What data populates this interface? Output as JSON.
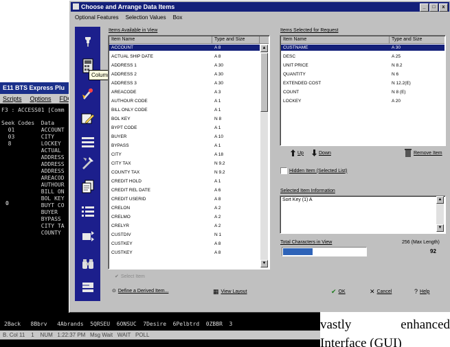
{
  "terminal": {
    "title": "E11 BTS Express Plu",
    "menu": [
      "Scripts",
      "Options",
      "FDC"
    ],
    "lines": [
      "F3 : ACCESS01 [Comm",
      "Seek Codes  Data",
      "  01        ACCOUNT",
      "  03        CITY",
      "  8         LOCKEY",
      "            ACTUAL",
      "            ADDRESS",
      "            ADDRESS",
      "            ADDRESS",
      "            AREACOD",
      "            AUTHOUR",
      "            BILL ON",
      "            BOL KEY",
      "            BUYT CO",
      "            BUYER",
      "            BYPASS",
      "            CITY TA",
      "            COUNTY"
    ],
    "cursor_char": "0",
    "status_line": "2Back   8Bbrv   4Abrands  5QRSEU  6ONSUC  7Desire  6Pelbtrd  0ZBBR  3",
    "status_bar": "B. Col 11    1    NUM   1:22:37 PM   Msg Wait   WAIT   POLL"
  },
  "dialog": {
    "title": "Choose and Arrange Data Items",
    "window_buttons": [
      "_",
      "□",
      "x"
    ],
    "menu": [
      "Optional Features",
      "Selection Values",
      "Box"
    ],
    "tooltip": "Column Calculations",
    "available": {
      "label": "Items Available in View",
      "col_name": "Item Name",
      "col_type": "Type and Size",
      "rows": [
        {
          "name": "ACCOUNT",
          "type": "A 8",
          "selected": true
        },
        {
          "name": "ACTUAL SHIP DATE",
          "type": "A 8"
        },
        {
          "name": "ADDRESS 1",
          "type": "A 30"
        },
        {
          "name": "ADDRESS 2",
          "type": "A 30"
        },
        {
          "name": "ADDRESS 3",
          "type": "A 30"
        },
        {
          "name": "AREACODE",
          "type": "A 3"
        },
        {
          "name": "AUTHOUR CODE",
          "type": "A 1"
        },
        {
          "name": "BILL ONLY CODE",
          "type": "A 1"
        },
        {
          "name": "BOL KEY",
          "type": "N 8"
        },
        {
          "name": "BYPT CODE",
          "type": "A 1"
        },
        {
          "name": "BUYER",
          "type": "A 10"
        },
        {
          "name": "BYPASS",
          "type": "A 1"
        },
        {
          "name": "CITY",
          "type": "A 18"
        },
        {
          "name": "CITY TAX",
          "type": "N 9.2"
        },
        {
          "name": "COUNTY TAX",
          "type": "N 9.2"
        },
        {
          "name": "CREDIT HOLD",
          "type": "A 1"
        },
        {
          "name": "CREDIT REL DATE",
          "type": "A 6"
        },
        {
          "name": "CREDIT USERID",
          "type": "A 8"
        },
        {
          "name": "CRELON",
          "type": "A 2"
        },
        {
          "name": "CRELMO",
          "type": "A 2"
        },
        {
          "name": "CRELYR",
          "type": "A 2"
        },
        {
          "name": "CUSTDIV",
          "type": "N 1"
        },
        {
          "name": "CUSTKEY",
          "type": "A 8"
        },
        {
          "name": "CUSTKEY",
          "type": "A 8"
        }
      ]
    },
    "selected": {
      "label": "Items Selected for Request",
      "col_name": "Item Name",
      "col_type": "Type and Size",
      "rows": [
        {
          "name": "CUSTNAME",
          "type": "A 30",
          "selected": true
        },
        {
          "name": "DESC",
          "type": "A 25"
        },
        {
          "name": "UNIT PRICE",
          "type": "N 8.2"
        },
        {
          "name": "QUANTITY",
          "type": "N 6"
        },
        {
          "name": "EXTENDED COST",
          "type": "N 12.2(E)"
        },
        {
          "name": "COUNT",
          "type": "N 8 (E)"
        },
        {
          "name": "LOCKEY",
          "type": "A 20"
        }
      ]
    },
    "up_label": "Up",
    "down_label": "Down",
    "remove_label": "Remove Item",
    "hidden_items_label": "Hidden Item (Selected List)",
    "sel_info_label": "Selected Item Information",
    "sel_info_text": "Sort Key (1) A",
    "total_label": "Total Characters in View",
    "max_label": "256 (Max Length)",
    "total_value": "92",
    "total_fraction": 0.36,
    "select_label": "Select Item",
    "define_label": "Define a Derived Item...",
    "view_layout_label": "View Layout",
    "ok_label": "OK",
    "cancel_label": "Cancel",
    "help_label": "Help"
  },
  "article": {
    "line1_a": "vastly",
    "line1_b": "enhanced",
    "line2": "Interface (GUI)"
  },
  "colors": {
    "title_bar": "#14207a",
    "icon_bar": "#1c1f8c",
    "selection": "#14207a",
    "dialog_face": "#c0c0c0",
    "progress": "#2e63b8"
  }
}
